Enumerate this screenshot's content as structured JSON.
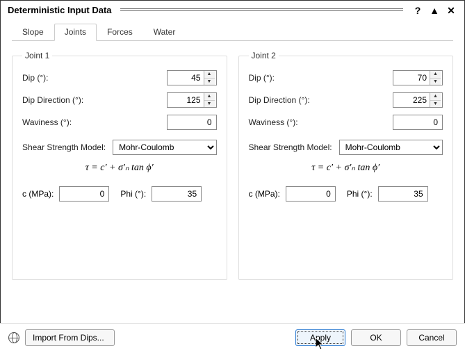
{
  "window": {
    "title": "Deterministic Input Data"
  },
  "tabs": {
    "slope": "Slope",
    "joints": "Joints",
    "forces": "Forces",
    "water": "Water"
  },
  "labels": {
    "dip": "Dip (°):",
    "dipdir": "Dip Direction (°):",
    "wav": "Waviness (°):",
    "ssm": "Shear Strength Model:",
    "c": "c (MPa):",
    "phi": "Phi (°):"
  },
  "models": {
    "mohr": "Mohr-Coulomb"
  },
  "formula": "τ = c′ + σ′ₙ tan ϕ′",
  "joint1": {
    "legend": "Joint 1",
    "dip": "45",
    "dipdir": "125",
    "wav": "0",
    "c": "0",
    "phi": "35"
  },
  "joint2": {
    "legend": "Joint 2",
    "dip": "70",
    "dipdir": "225",
    "wav": "0",
    "c": "0",
    "phi": "35"
  },
  "footer": {
    "import": "Import From Dips...",
    "apply": "Apply",
    "ok": "OK",
    "cancel": "Cancel"
  }
}
